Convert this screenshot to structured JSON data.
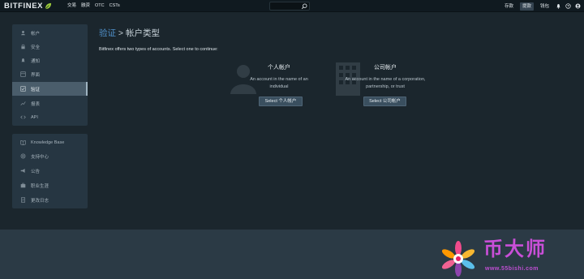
{
  "header": {
    "logo_text": "BITFINEX",
    "nav": [
      "交易",
      "融资",
      "OTC",
      "CSTs"
    ],
    "search": {
      "placeholder": ""
    },
    "right": {
      "deposit": "存款",
      "withdraw": "提款",
      "wallet": "钱包"
    }
  },
  "sidebar": {
    "main_items": [
      {
        "label": "帐户",
        "icon": "user-icon"
      },
      {
        "label": "安全",
        "icon": "lock-icon"
      },
      {
        "label": "通知",
        "icon": "bell-icon"
      },
      {
        "label": "界面",
        "icon": "layout-icon"
      },
      {
        "label": "验证",
        "icon": "check-icon",
        "active": true
      },
      {
        "label": "报表",
        "icon": "chart-icon"
      },
      {
        "label": "API",
        "icon": "code-icon"
      }
    ],
    "help_items": [
      {
        "label": "Knowledge Base",
        "icon": "book-icon"
      },
      {
        "label": "支持中心",
        "icon": "support-icon"
      },
      {
        "label": "公告",
        "icon": "megaphone-icon"
      },
      {
        "label": "职业生涯",
        "icon": "briefcase-icon"
      },
      {
        "label": "更改日志",
        "icon": "document-icon"
      }
    ]
  },
  "main": {
    "breadcrumb_link": "验证",
    "breadcrumb_sep": " > ",
    "title": "帐户类型",
    "intro": "Bitfinex offers two types of accounts. Select one to continue:",
    "personal": {
      "title": "个人帐户",
      "desc_line1": "An account in the name of an",
      "desc_line2": "individual",
      "button": "Select 个人帐户"
    },
    "corporate": {
      "title": "公司帐户",
      "desc_line1": "An account in the name of a corporation,",
      "desc_line2": "partnership, or trust",
      "button": "Select 公司帐户"
    }
  },
  "watermark": {
    "text": "币大师",
    "url": "www.55bishi.com"
  },
  "colors": {
    "background": "#1b262d",
    "panel": "#263642",
    "link": "#4f8fc8",
    "accent_watermark": "#c94fd8"
  }
}
